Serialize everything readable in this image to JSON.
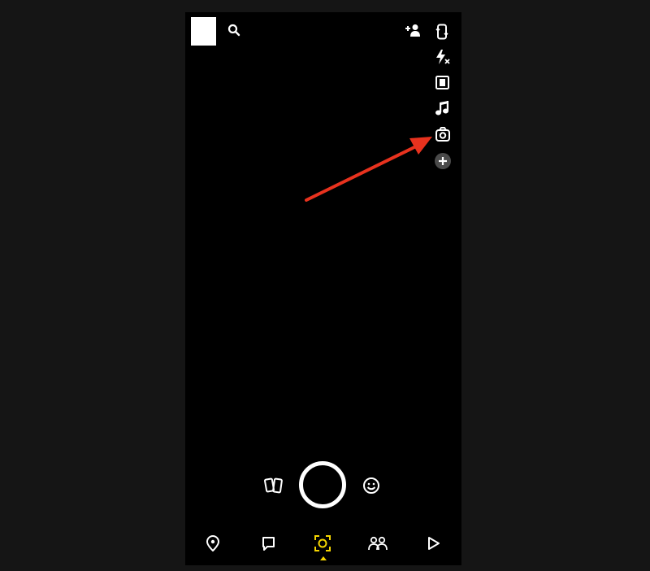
{
  "colors": {
    "background": "#151515",
    "screen": "#000000",
    "icon": "#ffffff",
    "active_nav": "#f5d600",
    "annotation_arrow": "#e8321e"
  },
  "header": {
    "avatar": "profile-avatar",
    "search_icon": "search-icon",
    "add_friend_icon": "add-friend-icon"
  },
  "camera_tools": [
    "flip-camera-icon",
    "flash-off-icon",
    "video-mode-icon",
    "music-icon",
    "dual-camera-icon",
    "plus-circle-icon"
  ],
  "capture": {
    "memories_icon": "memories-icon",
    "shutter": "shutter-button",
    "lenses_icon": "lenses-icon"
  },
  "bottom_nav": [
    "map-icon",
    "chat-icon",
    "camera-icon",
    "stories-icon",
    "spotlight-icon"
  ],
  "annotation": "red-arrow-pointing-to-dual-camera-icon"
}
